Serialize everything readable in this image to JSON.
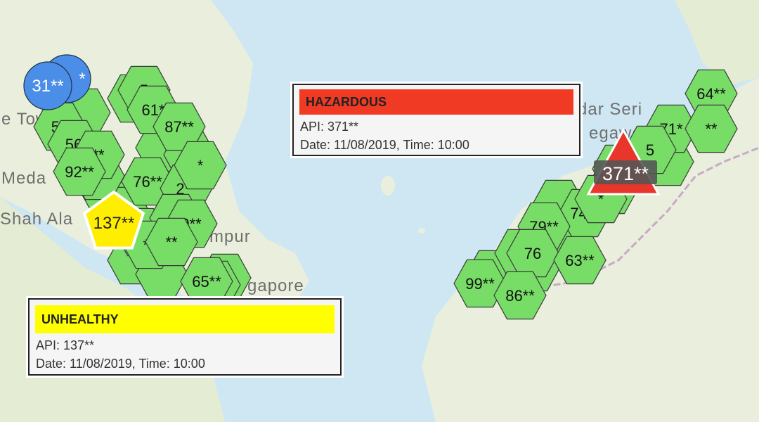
{
  "map": {
    "place_labels": [
      {
        "id": "tow",
        "text": "e Tow"
      },
      {
        "id": "medan",
        "text": "Meda"
      },
      {
        "id": "shah-alam",
        "text": "Shah Ala"
      },
      {
        "id": "kl",
        "text": "mpur"
      },
      {
        "id": "singapore",
        "text": "gapore"
      },
      {
        "id": "bandar-seri",
        "text": "dar Seri"
      },
      {
        "id": "begawan",
        "text": "egawa"
      }
    ],
    "legend_colors": {
      "good": "#77dd66",
      "moderate": "#4a8ee8",
      "unhealthy": "#ffee00",
      "hazardous": "#e8362a"
    }
  },
  "markers": {
    "blue": [
      {
        "label": "31**"
      },
      {
        "label": "*"
      }
    ],
    "green_west": [
      "5",
      "61*",
      "87**",
      "55",
      "56",
      "**",
      "92**",
      "76**",
      "2**",
      "*",
      "*",
      "9**",
      "**",
      "**",
      "65**"
    ],
    "green_east": [
      "64**",
      "71*",
      "**",
      "5",
      "74**",
      "*",
      "79**",
      "7",
      "76",
      "63**",
      "99**",
      "86**"
    ],
    "unhealthy": {
      "label": "137**"
    },
    "hazardous": {
      "label": "371**"
    }
  },
  "popups": {
    "hazardous": {
      "category": "HAZARDOUS",
      "api": "API: 371**",
      "date": "Date: 11/08/2019, Time: 10:00",
      "color": "#f03a24"
    },
    "unhealthy": {
      "category": "UNHEALTHY",
      "api": "API: 137**",
      "date": "Date: 11/08/2019, Time: 10:00",
      "color": "#ffff00"
    }
  }
}
